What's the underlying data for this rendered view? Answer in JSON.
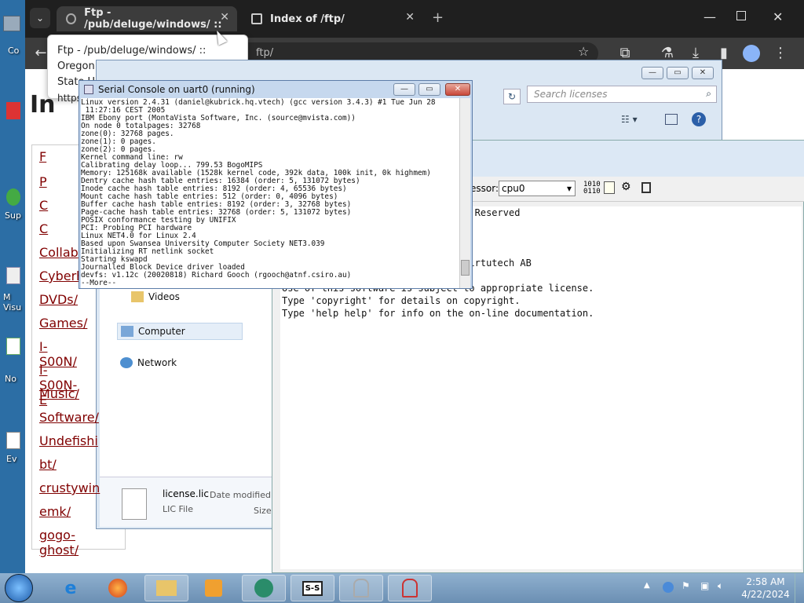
{
  "desktop": {
    "icon_labels": [
      "Co",
      "Sup",
      "M Visu",
      "No",
      "Ev"
    ]
  },
  "chrome": {
    "tabs": [
      {
        "label": "Ftp - /pub/deluge/windows/ ::"
      },
      {
        "label": "Index of /ftp/"
      }
    ],
    "address_fragment": "ftp/",
    "tooltip": {
      "line1": "Ftp - /pub/deluge/windows/ :: Oregon",
      "line2": "State Ur",
      "line3": "https"
    },
    "heading": "In",
    "links": [
      "F",
      "P",
      "C",
      "C",
      "Collab",
      "Cyberh",
      "DVDs/",
      "Games/",
      "I-S00N/",
      "I-S00N-E",
      "Music/",
      "Software/",
      "Undefishi",
      "bt/",
      "crustywin",
      "emk/",
      "gogo-ghost/"
    ]
  },
  "explorer": {
    "search_placeholder": "Search licenses",
    "nav": {
      "videos": "Videos",
      "computer": "Computer",
      "network": "Network"
    },
    "file": {
      "name": "license.lic",
      "type": "LIC File",
      "date_label": "Date modified:",
      "size_label": "Size:"
    }
  },
  "console": {
    "title": "Serial Console on uart0 (running)",
    "lines": "Linux version 2.4.31 (daniel@kubrick.hq.vtech) (gcc version 3.4.3) #1 Tue Jun 28\n 11:27:16 CEST 2005\nIBM Ebony port (MontaVista Software, Inc. (source@mvista.com))\nOn node 0 totalpages: 32768\nzone(0): 32768 pages.\nzone(1): 0 pages.\nzone(2): 0 pages.\nKernel command line: rw\nCalibrating delay loop... 799.53 BogoMIPS\nMemory: 125168k available (1528k kernel code, 392k data, 100k init, 0k highmem)\nDentry cache hash table entries: 16384 (order: 5, 131072 bytes)\nInode cache hash table entries: 8192 (order: 4, 65536 bytes)\nMount cache hash table entries: 512 (order: 0, 4096 bytes)\nBuffer cache hash table entries: 8192 (order: 3, 32768 bytes)\nPage-cache hash table entries: 32768 (order: 5, 131072 bytes)\nPOSIX conformance testing by UNIFIX\nPCI: Probing PCI hardware\nLinux NET4.0 for Linux 2.4\nBased upon Swansea University Computer Society NET3.039\nInitializing RT netlink socket\nStarting kswapd\nJournalled Block Device driver loaded\ndevfs: v1.12c (20020818) Richard Gooch (rgooch@atnf.csiro.au)\n--More-- "
  },
  "simics": {
    "processor_label": "essor:",
    "processor_value": "cpu0",
    "output": "998-2007 by Virtutech, All Rights Reserved\nmics 3.0.31\n    Host: x86-win32\n\n and \"Simics\" are trademarks of Virtutech AB\n\nUse of this software is subject to appropriate license.\nType 'copyright' for details on copyright.\nType 'help help' for info on the on-line documentation."
  },
  "taskbar": {
    "time": "2:58 AM",
    "date": "4/22/2024",
    "tray_icon_label": "S-S"
  }
}
